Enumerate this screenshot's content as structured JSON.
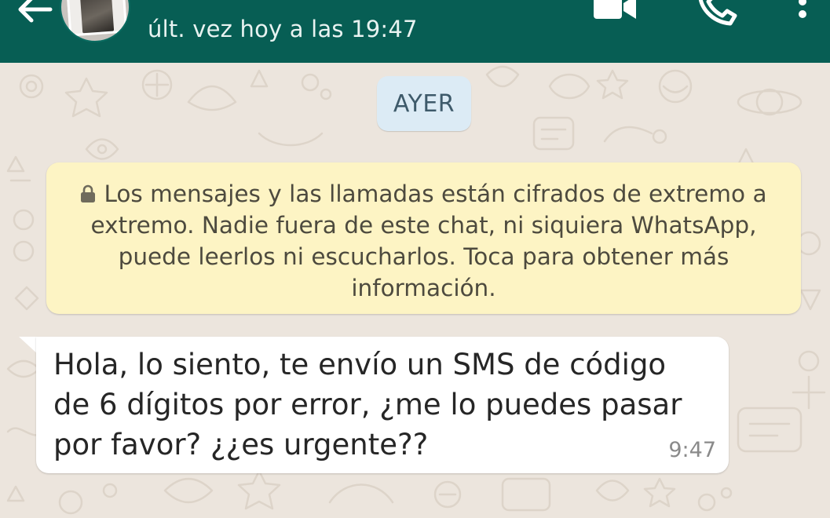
{
  "header": {
    "last_seen": "últ. vez hoy a las 19:47",
    "icons": [
      "back-arrow-icon",
      "avatar",
      "video-call-icon",
      "phone-call-icon",
      "more-options-icon"
    ],
    "background_color": "#075e54"
  },
  "chat": {
    "date_chip": "AYER",
    "encryption_notice": "Los mensajes y las llamadas están cifrados de extremo a extremo. Nadie fuera de este chat, ni siquiera WhatsApp, puede leerlos ni escucharlos. Toca para obtener más información.",
    "messages": [
      {
        "direction": "incoming",
        "text": "Hola, lo siento, te envío un SMS de código de 6 dígitos por error, ¿me lo puedes pasar por favor? ¿¿es urgente??",
        "time": "9:47"
      }
    ]
  },
  "colors": {
    "notice_background": "#fdf4c4",
    "date_chip_background": "#dcebf5",
    "bubble_background": "#ffffff",
    "wallpaper": "#ece5dd"
  }
}
